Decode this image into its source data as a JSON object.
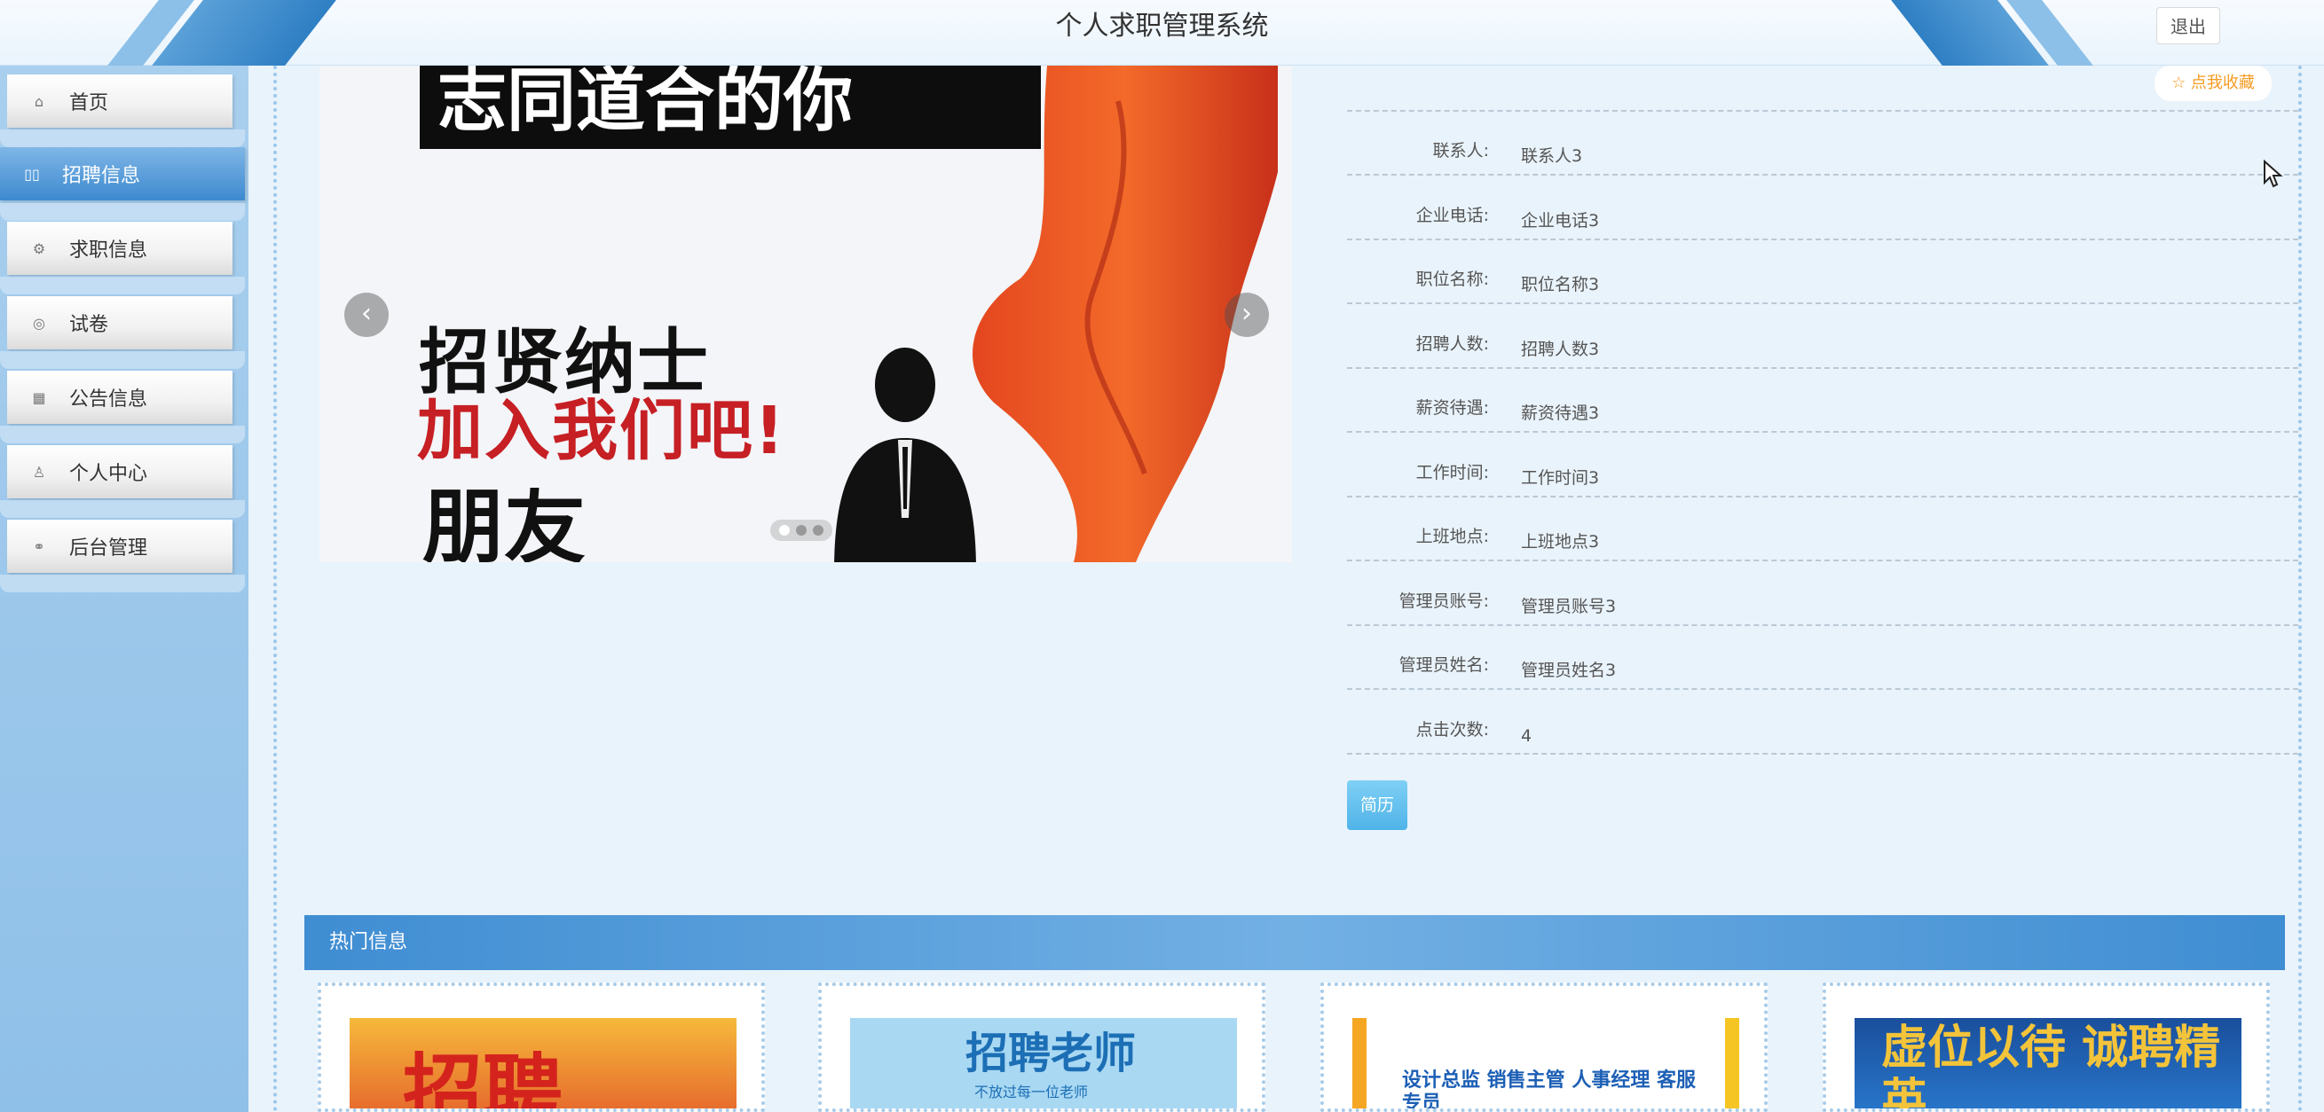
{
  "header": {
    "title": "个人求职管理系统",
    "logout_label": "退出"
  },
  "sidebar": {
    "items": [
      {
        "label": "首页",
        "icon": "home-icon",
        "active": false
      },
      {
        "label": "招聘信息",
        "icon": "grid-icon",
        "active": true
      },
      {
        "label": "求职信息",
        "icon": "gear-icon",
        "active": false
      },
      {
        "label": "试卷",
        "icon": "paper-icon",
        "active": false
      },
      {
        "label": "公告信息",
        "icon": "notice-icon",
        "active": false
      },
      {
        "label": "个人中心",
        "icon": "user-icon",
        "active": false
      },
      {
        "label": "后台管理",
        "icon": "link-icon",
        "active": false
      }
    ]
  },
  "banner": {
    "top_text": "志同道合的你",
    "line1": "招贤纳士",
    "line2": "加入我们吧!",
    "line3": "朋友",
    "prev": "‹",
    "next": "›",
    "slide_count": 3,
    "active_slide": 1
  },
  "favorite_label": "☆ 点我收藏",
  "details": [
    {
      "label": "联系人:",
      "value": "联系人3"
    },
    {
      "label": "企业电话:",
      "value": "企业电话3"
    },
    {
      "label": "职位名称:",
      "value": "职位名称3"
    },
    {
      "label": "招聘人数:",
      "value": "招聘人数3"
    },
    {
      "label": "薪资待遇:",
      "value": "薪资待遇3"
    },
    {
      "label": "工作时间:",
      "value": "工作时间3"
    },
    {
      "label": "上班地点:",
      "value": "上班地点3"
    },
    {
      "label": "管理员账号:",
      "value": "管理员账号3"
    },
    {
      "label": "管理员姓名:",
      "value": "管理员姓名3"
    },
    {
      "label": "点击次数:",
      "value": "4"
    }
  ],
  "resume_button": "简历",
  "hot": {
    "title": "热门信息",
    "cards": [
      {
        "text": "招聘"
      },
      {
        "text": "招聘老师",
        "sub": "不放过每一位老师"
      },
      {
        "text": "设计总监 销售主管 人事经理 客服专员"
      },
      {
        "text": "虚位以待 诚聘精英"
      }
    ]
  },
  "colors": {
    "accent": "#3d8ad0",
    "favorite": "#f59b22",
    "resume": "#4fb3e8"
  }
}
